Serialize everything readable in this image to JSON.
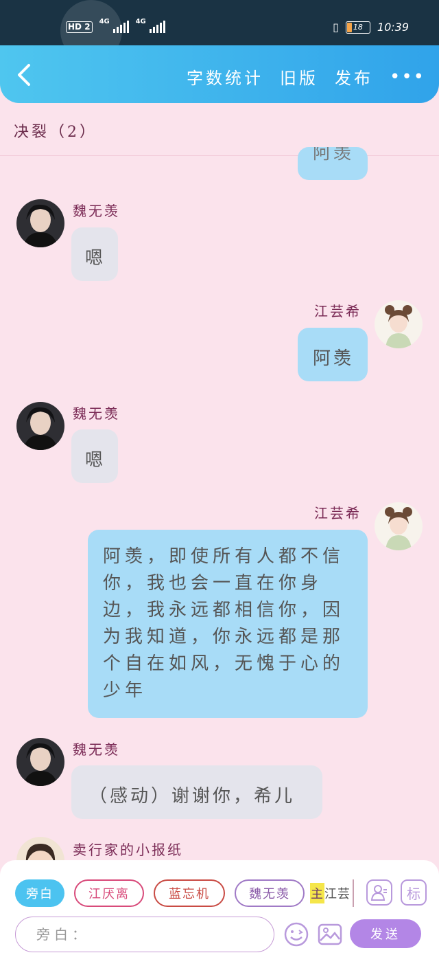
{
  "status": {
    "hd_label": "HD",
    "sim": "2",
    "net1": "4G",
    "net2": "4G",
    "battery": "18",
    "time": "10:39"
  },
  "header": {
    "actions": [
      "字数统计",
      "旧版",
      "发布"
    ],
    "more": "•••"
  },
  "chat": {
    "title": "决裂（2）",
    "messages": [
      {
        "side": "right",
        "name": "",
        "text": "阿羡"
      },
      {
        "side": "left",
        "name": "魏无羡",
        "text": "嗯"
      },
      {
        "side": "right",
        "name": "江芸希",
        "text": "阿羡"
      },
      {
        "side": "left",
        "name": "魏无羡",
        "text": "嗯"
      },
      {
        "side": "right",
        "name": "江芸希",
        "text": "阿羡，即使所有人都不信你，我也会一直在你身边，我永远都相信你，因为我知道，你永远都是那个自在如风，无愧于心的少年"
      },
      {
        "side": "left",
        "name": "魏无羡",
        "text": "（感动）谢谢你，希儿"
      },
      {
        "side": "left",
        "name": "卖行家的小报纸",
        "text": ""
      }
    ]
  },
  "composer": {
    "roles": [
      "旁白",
      "江厌离",
      "蓝忘机",
      "魏无羡"
    ],
    "main_badge": "主",
    "main_role": "江芸",
    "placeholder": "旁白：",
    "send_label": "发送",
    "tag_label": "标"
  },
  "colors": {
    "header": "#30a3ea",
    "background": "#fbe3ec",
    "right_bubble": "#a8dcf7",
    "left_bubble": "#e4e4ec",
    "send": "#b386e6"
  }
}
